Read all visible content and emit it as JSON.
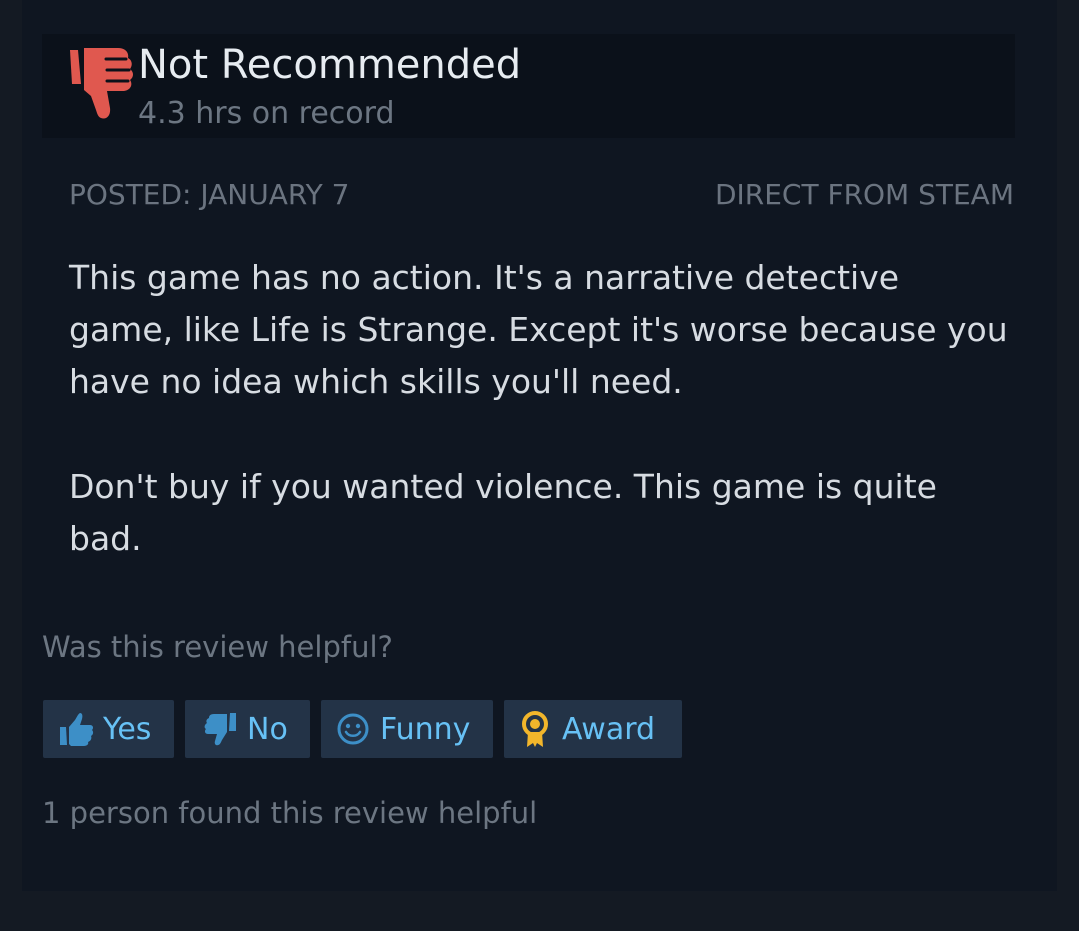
{
  "review": {
    "verdict": "Not Recommended",
    "hours": "4.3 hrs on record",
    "posted": "POSTED: JANUARY 7",
    "source": "DIRECT FROM STEAM",
    "paragraphs": [
      "This game has no action. It's a narrative detective game, like Life is Strange. Except it's worse because you have no idea which skills you'll need.",
      "Don't buy if you wanted violence. This game is quite bad."
    ]
  },
  "feedback": {
    "question": "Was this review helpful?",
    "buttons": {
      "yes": "Yes",
      "no": "No",
      "funny": "Funny",
      "award": "Award"
    },
    "helpful_count": "1 person found this review helpful"
  },
  "icons": {
    "verdict": "thumbs-down-icon",
    "yes": "thumbs-up-icon",
    "no": "thumbs-down-icon",
    "funny": "smiley-icon",
    "award": "award-ribbon-icon"
  },
  "colors": {
    "not_recommended": "#e0584f",
    "button_text": "#67c1f5",
    "button_bg": "#233347",
    "award": "#f2b62b"
  }
}
